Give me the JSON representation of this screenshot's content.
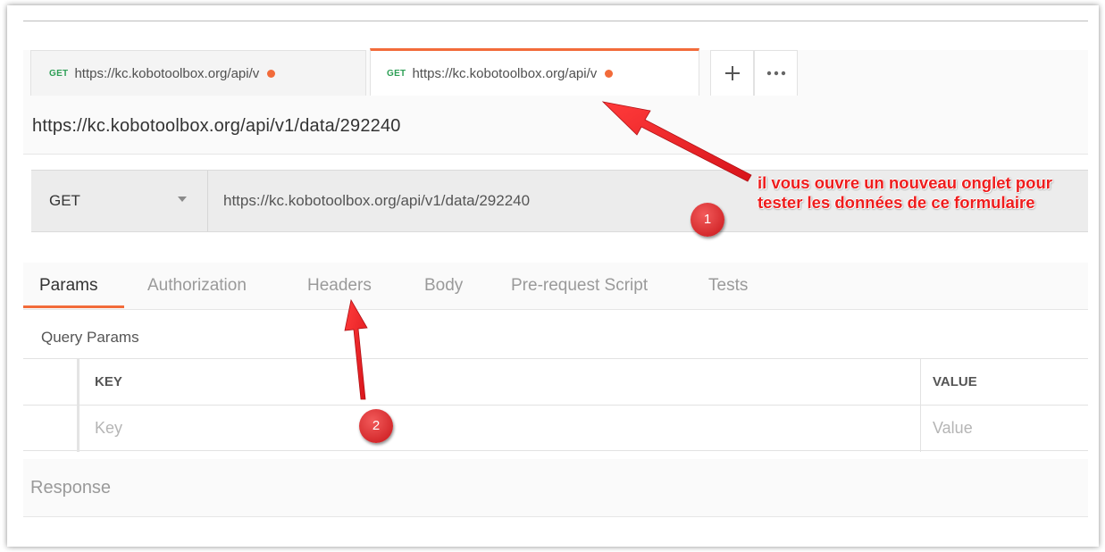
{
  "tabs": [
    {
      "method": "GET",
      "url": "https://kc.kobotoolbox.org/api/v",
      "unsaved": true,
      "active": false
    },
    {
      "method": "GET",
      "url": "https://kc.kobotoolbox.org/api/v",
      "unsaved": true,
      "active": true
    }
  ],
  "tab_tools": {
    "new_tab_icon": "plus-icon",
    "more_icon": "ellipsis-icon"
  },
  "request": {
    "title": "https://kc.kobotoolbox.org/api/v1/data/292240",
    "method": "GET",
    "url": "https://kc.kobotoolbox.org/api/v1/data/292240"
  },
  "request_tabs": {
    "active": "Params",
    "items": [
      "Params",
      "Authorization",
      "Headers",
      "Body",
      "Pre-request Script",
      "Tests"
    ]
  },
  "query_params": {
    "label": "Query Params",
    "columns": {
      "key": "KEY",
      "value": "VALUE"
    },
    "placeholders": {
      "key": "Key",
      "value": "Value"
    }
  },
  "response": {
    "label": "Response"
  },
  "annotations": {
    "callout_text": "il vous ouvre un nouveau onglet pour tester les données de ce formulaire",
    "badge_1": "1",
    "badge_2": "2"
  },
  "colors": {
    "accent": "#f26b3a",
    "method_get": "#2e9f56",
    "annotation_red": "#ee1c1c"
  }
}
